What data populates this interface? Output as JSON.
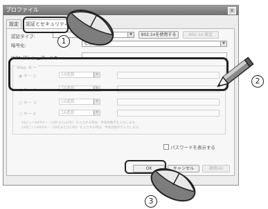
{
  "window": {
    "title": "プロファイル"
  },
  "tabs": [
    {
      "label": "設定"
    },
    {
      "label": "認証とセキュリティ"
    }
  ],
  "auth": {
    "type_label": "認証タイプ:",
    "encryption_label": "暗号化:",
    "encryption_value": "なし",
    "use_8021x_label": "802.1xを使用する",
    "setting_label": "802.1x 設定"
  },
  "wpa": {
    "label": "WPA プレシェアードキー:"
  },
  "wep": {
    "group_label": "Wep キー",
    "keys": [
      {
        "label": "キー 1",
        "combo": "16進数"
      },
      {
        "label": "キー 2",
        "combo": "16進数"
      },
      {
        "label": "キー 3",
        "combo": "16進数"
      },
      {
        "label": "キー 4",
        "combo": "16進数"
      }
    ],
    "note1": "64ビットWEPキー（10桁または5桁）を入力する時は、半角英数字を入力します。",
    "note2": "128ビットWEPキー（26桁または13桁）を入力する時は、半角英数字を入力します。"
  },
  "show_password_label": "パスワードを表示する",
  "buttons": {
    "ok": "OK",
    "cancel": "キャンセル",
    "apply": "適用(A)"
  },
  "callouts": [
    "1",
    "2",
    "3"
  ],
  "colors": {
    "callout": "#222222",
    "titlebar": "#7a7a7a"
  }
}
